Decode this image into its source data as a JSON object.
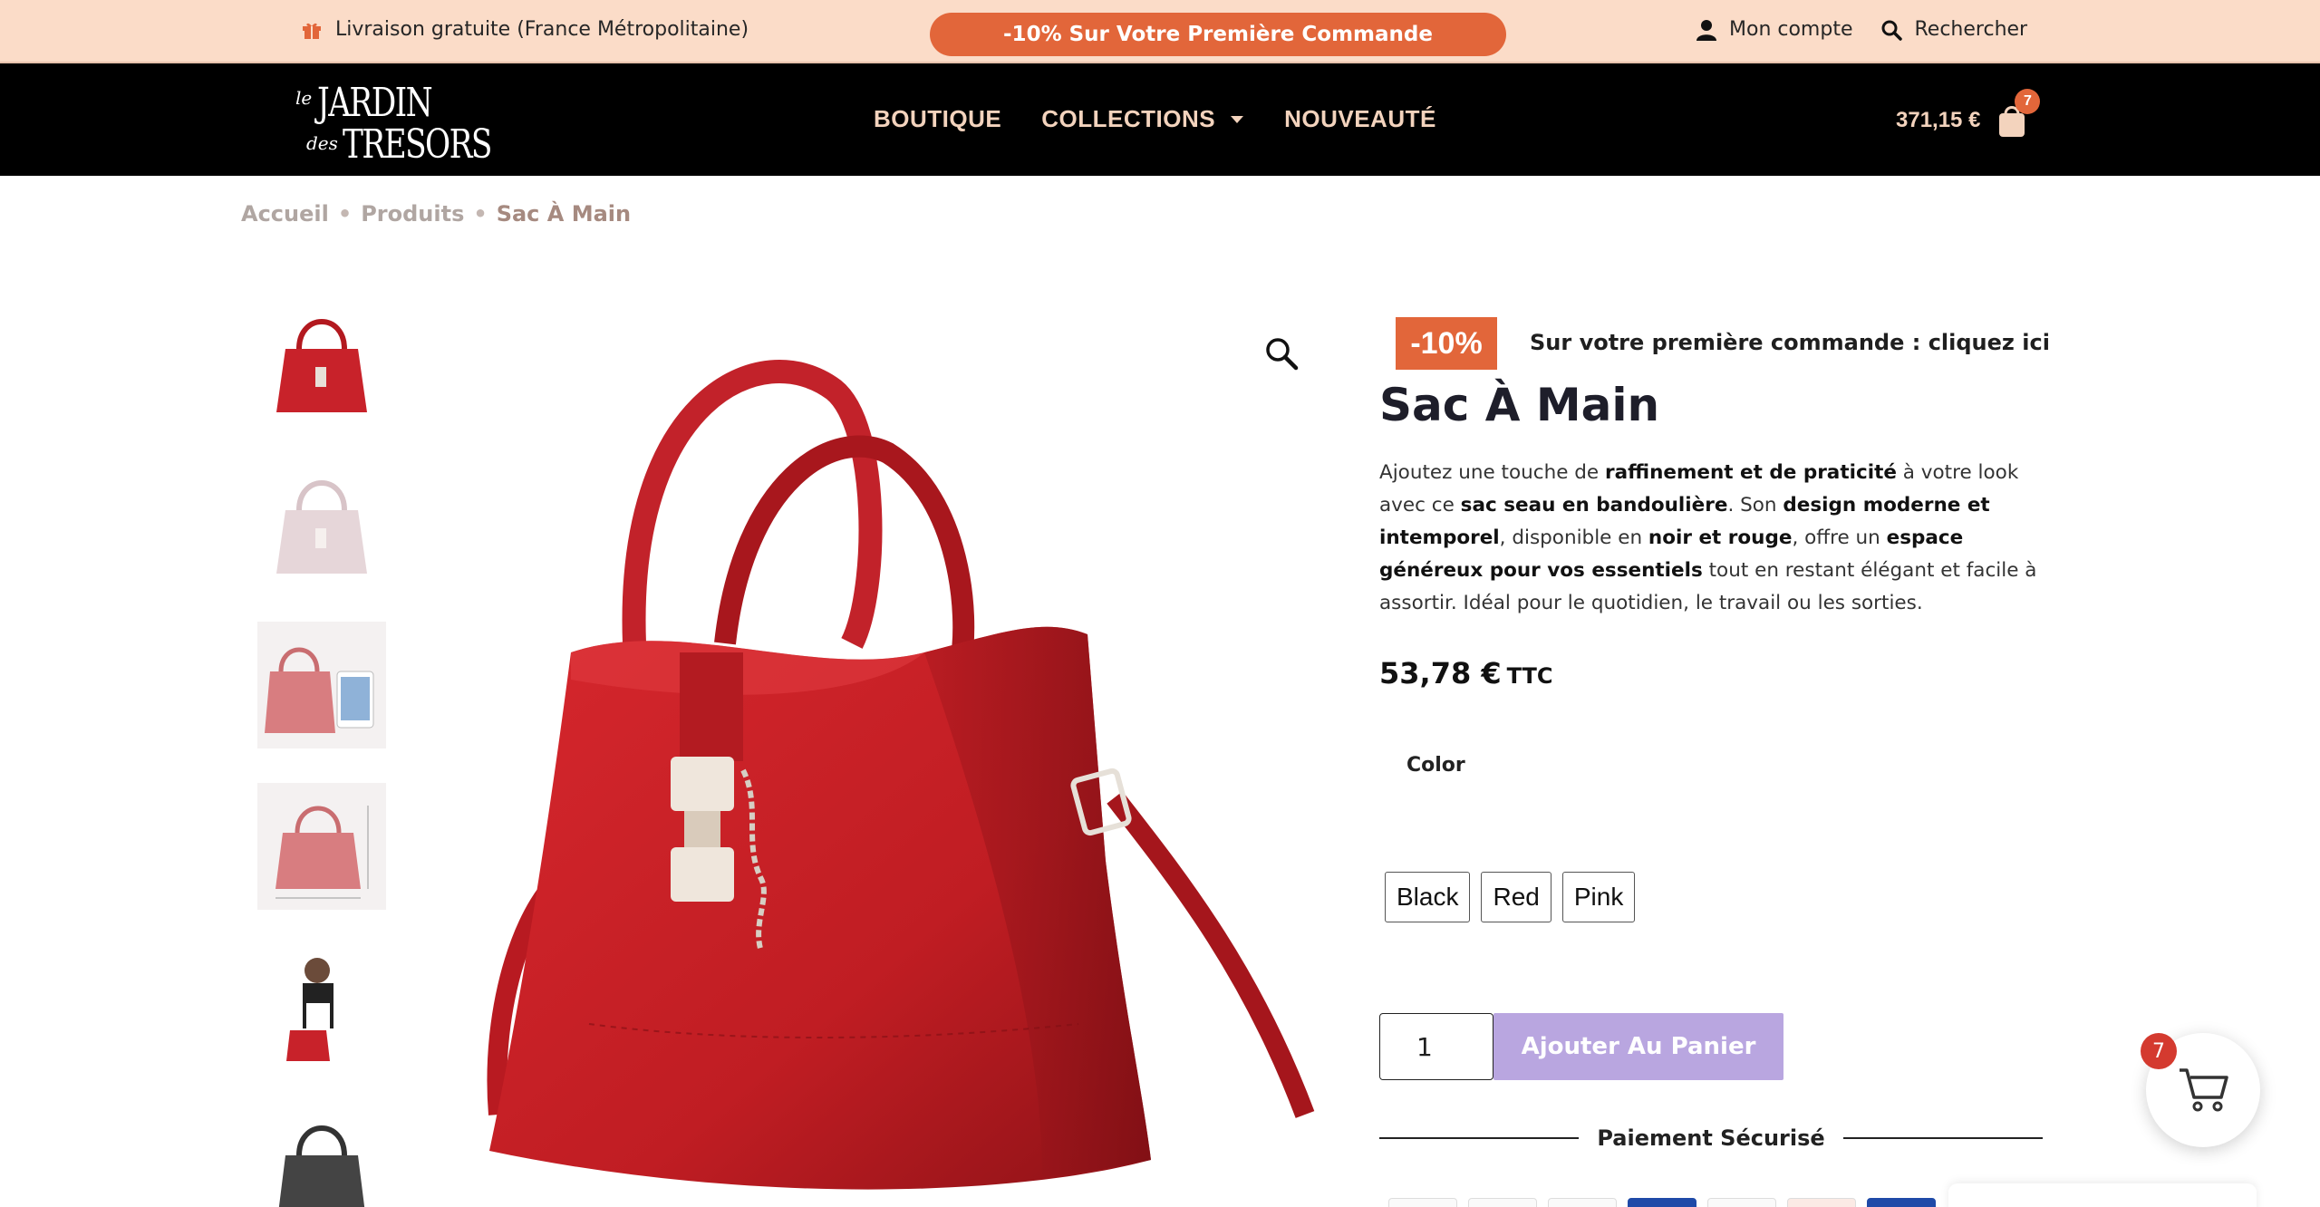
{
  "topbar": {
    "shipping_text": "Livraison gratuite (France Métropolitaine)",
    "promo_label": "-10% Sur Votre Première Commande",
    "account_label": "Mon compte",
    "search_label": "Rechercher",
    "background_color": "#fbdcc8",
    "promo_color": "#e2663a"
  },
  "header": {
    "logo": {
      "line1_small": "le",
      "line1": "JARDIN",
      "line2_small": "des",
      "line2": "TRESORS"
    },
    "nav": [
      {
        "label": "BOUTIQUE"
      },
      {
        "label": "COLLECTIONS"
      },
      {
        "label": "NOUVEAUTÉ"
      }
    ],
    "cart_total": "371,15 €",
    "cart_count": "7"
  },
  "breadcrumb": {
    "items": [
      "Accueil",
      "Produits"
    ],
    "current": "Sac À Main"
  },
  "thumbnails": [
    {
      "name": "red-bag"
    },
    {
      "name": "pink-bag"
    },
    {
      "name": "red-bag-with-tablet"
    },
    {
      "name": "red-bag-dimensions"
    },
    {
      "name": "model-with-red-bag"
    },
    {
      "name": "black-bag"
    }
  ],
  "product": {
    "promo_badge": "-10%",
    "promo_text": "Sur votre première commande : cliquez ici",
    "title": "Sac À Main",
    "description": {
      "p1": "Ajoutez une touche de ",
      "b1": "raffinement et de praticité",
      "p2": " à votre look avec ce ",
      "b2": "sac seau en bandoulière",
      "p3": ". Son ",
      "b3": "design moderne et intemporel",
      "p4": ", disponible en ",
      "b4": "noir et rouge",
      "p5": ", offre un ",
      "b5": "espace généreux pour vos essentiels",
      "p6": " tout en restant élégant et facile à assortir. Idéal pour le quotidien, le travail ou les sorties."
    },
    "price": "53,78 €",
    "price_suffix": "TTC",
    "color_label": "Color",
    "color_options": [
      "Black",
      "Red",
      "Pink"
    ],
    "quantity": "1",
    "add_to_cart_label": "Ajouter Au Panier",
    "secure_payment_label": "Paiement Sécurisé",
    "accent_color": "#b9a6e0"
  },
  "floating_cart": {
    "count": "7"
  }
}
